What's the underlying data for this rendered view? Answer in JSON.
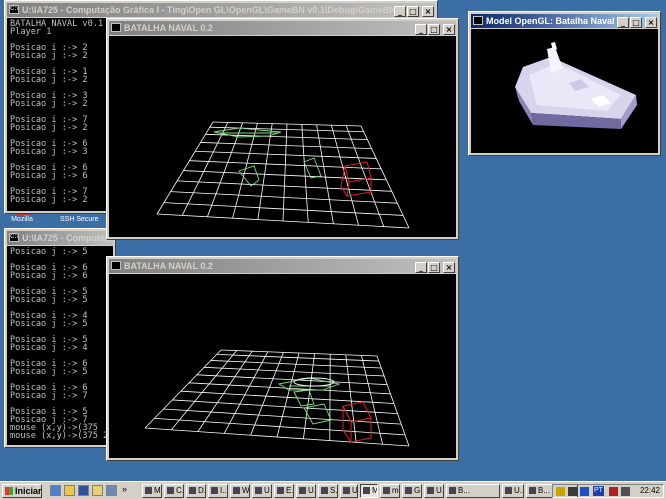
{
  "desktop": {
    "icons": [
      {
        "label": "Mozilla"
      },
      {
        "label": "SSH Secure"
      }
    ]
  },
  "console_top": {
    "title": "U:\\IA725 - Computação Gráfica I - Ting\\Open GL\\OpenGL\\GameBN v0.1\\Debug\\GameBN.exe",
    "lines": "BATALHA NAVAL v0.1\nPlayer 1\n\nPosicao i :-> 2\nPosicao j :-> 2\n\nPosicao i :-> 1\nPosicao j :-> 2\n\nPosicao i :-> 3\nPosicao j :-> 2\n\nPosicao i :-> 7\nPosicao j :-> 2\n\nPosicao i :-> 6\nPosicao j :-> 3\n\nPosicao i :-> 6\nPosicao j :-> 6\n\nPosicao i :-> 7\nPosicao j :-> 2\n\nPosicao i :-> 2"
  },
  "console_bottom": {
    "title": "U:\\IA725 - Computação G",
    "lines": "Posicao j :-> 5\n\nPosicao i :-> 6\nPosicao j :-> 6\n\nPosicao i :-> 5\nPosicao j :-> 5\n\nPosicao i :-> 4\nPosicao j :-> 5\n\nPosicao i :-> 5\nPosicao j :-> 4\n\nPosicao i :-> 6\nPosicao j :-> 5\n\nPosicao i :-> 6\nPosicao j :-> 7\n\nPosicao i :-> 5\nPosicao j :-> 7\nmouse (x,y)->(375\nmouse (x,y)->(375 2"
  },
  "game_top": {
    "title": "BATALHA NAVAL 0.2"
  },
  "game_bottom": {
    "title": "BATALHA NAVAL 0.2"
  },
  "model_window": {
    "title": "Model OpenGL: Batalha Naval"
  },
  "window_buttons": {
    "minimize": "_",
    "maximize": "□",
    "close": "×"
  },
  "taskbar": {
    "start_label": "Iniciar",
    "buttons": [
      "M...",
      "C...",
      "D...",
      "I...",
      "W...",
      "U...",
      "E...",
      "U...",
      "S...",
      "U...",
      "M...",
      "m...",
      "G...",
      "U...",
      "B...",
      "U...",
      "B..."
    ],
    "tray_lang": "PT",
    "clock": "22:42"
  },
  "colors": {
    "desktop": "#3a6ea5",
    "grid": "#ffffff",
    "ship": "#7fdc7f",
    "cursor_box": "#e02020",
    "title_active": "#0a246a"
  }
}
